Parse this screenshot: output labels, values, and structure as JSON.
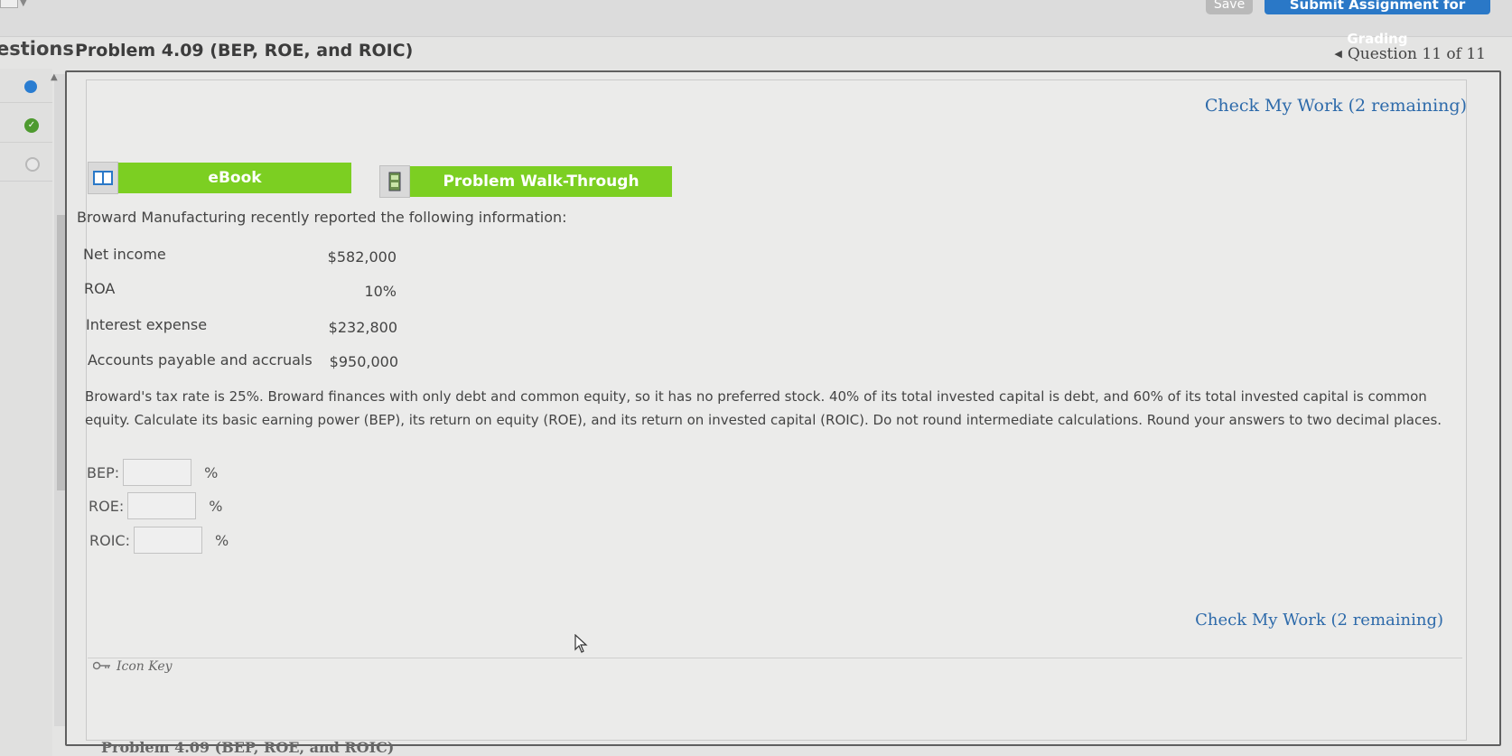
{
  "header": {
    "save_label": "Save",
    "submit_label": "Submit Assignment for Grading"
  },
  "sidebar": {
    "questions_label": "estions"
  },
  "problem": {
    "title": "Problem 4.09 (BEP, ROE, and ROIC)",
    "question_nav": "Question 11 of 11",
    "check_work_top": "Check My Work (2 remaining)",
    "check_work_bottom": "Check My Work (2 remaining)",
    "ebook_label": "eBook",
    "walkthrough_label": "Problem Walk-Through",
    "intro": "Broward Manufacturing recently reported the following information:",
    "given": [
      {
        "label": "Net income",
        "value": "$582,000"
      },
      {
        "label": "ROA",
        "value": "10%"
      },
      {
        "label": "Interest expense",
        "value": "$232,800"
      },
      {
        "label": "Accounts payable and accruals",
        "value": "$950,000"
      }
    ],
    "paragraph": "Broward's tax rate is 25%. Broward finances with only debt and common equity, so it has no preferred stock. 40% of its total invested capital is debt, and 60% of its total invested capital is common equity. Calculate its basic earning power (BEP), its return on equity (ROE), and its return on invested capital (ROIC). Do not round intermediate calculations. Round your answers to two decimal places.",
    "answers": [
      {
        "label": "BEP:",
        "value": "",
        "unit": "%"
      },
      {
        "label": "ROE:",
        "value": "",
        "unit": "%"
      },
      {
        "label": "ROIC:",
        "value": "",
        "unit": "%"
      }
    ],
    "icon_key_label": "Icon Key"
  },
  "footer": {
    "title": "Problem 4.09 (BEP, ROE, and ROIC)"
  },
  "colors": {
    "accent_blue": "#2a78c7",
    "button_green": "#7ccf22",
    "link_blue": "#2d6aaa"
  },
  "icons": {
    "ebook": "book-icon",
    "walkthrough": "film-icon",
    "icon_key": "key-icon"
  }
}
